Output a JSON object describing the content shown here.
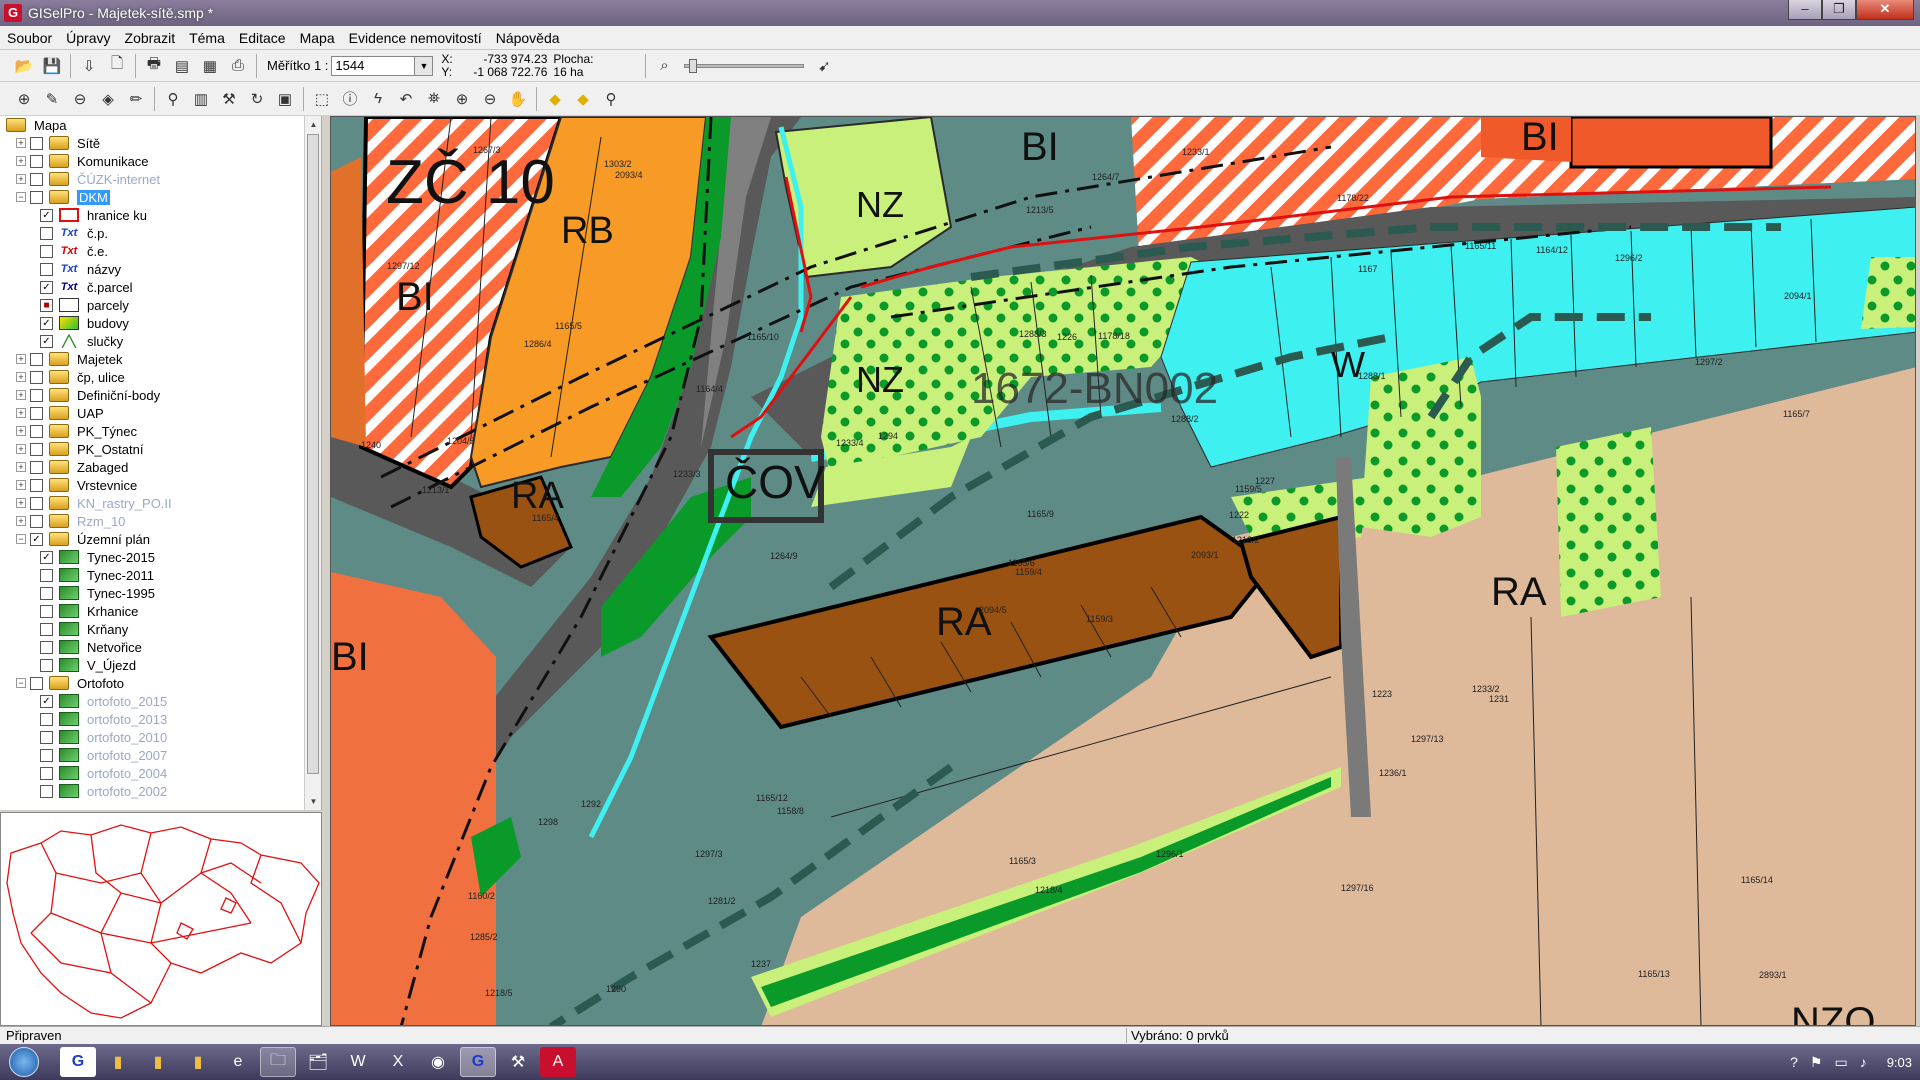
{
  "window": {
    "title": "GISelPro - Majetek-sítě.smp *",
    "minimize": "–",
    "maximize": "❐",
    "close": "✕",
    "app_icon": "G"
  },
  "menu": [
    "Soubor",
    "Úpravy",
    "Zobrazit",
    "Téma",
    "Editace",
    "Mapa",
    "Evidence nemovitostí",
    "Nápověda"
  ],
  "toolbar1": {
    "buttons_left": [
      {
        "name": "open-icon",
        "glyph": "📂"
      },
      {
        "name": "save-icon",
        "glyph": "💾"
      },
      {
        "name": "import-icon",
        "glyph": "⇩"
      },
      {
        "name": "new-page-icon",
        "glyph": "🗋"
      },
      {
        "name": "print-icon",
        "glyph": "🖶"
      },
      {
        "name": "print-preview-icon",
        "glyph": "▤"
      },
      {
        "name": "layout-icon",
        "glyph": "▦"
      },
      {
        "name": "export-icon",
        "glyph": "⎙"
      }
    ],
    "scale_label": "Měřítko 1 :",
    "scale_value": "1544",
    "x_label": "X:",
    "x_value": "-733 974.23",
    "y_label": "Y:",
    "y_value": "-1 068 722.76",
    "area_label": "Plocha:",
    "area_value": "16 ha",
    "zoom_icon": "⌕",
    "locate_icon": "➹"
  },
  "toolbar2": [
    {
      "name": "layer-add-icon",
      "glyph": "⊕"
    },
    {
      "name": "layer-edit-icon",
      "glyph": "✎"
    },
    {
      "name": "layer-remove-icon",
      "glyph": "⊖"
    },
    {
      "name": "compass-icon",
      "glyph": "◈"
    },
    {
      "name": "pen-icon",
      "glyph": "✏"
    },
    {
      "name": "binoculars-icon",
      "glyph": "⚲"
    },
    {
      "name": "calculator-icon",
      "glyph": "▥"
    },
    {
      "name": "tools-icon",
      "glyph": "⚒"
    },
    {
      "name": "refresh-icon",
      "glyph": "↻"
    },
    {
      "name": "grid-icon",
      "glyph": "▣"
    },
    {
      "name": "select-rect-icon",
      "glyph": "⬚"
    },
    {
      "name": "info-icon",
      "glyph": "ⓘ"
    },
    {
      "name": "lightning-icon",
      "glyph": "ϟ"
    },
    {
      "name": "undo-icon",
      "glyph": "↶"
    },
    {
      "name": "measure-icon",
      "glyph": "⛯"
    },
    {
      "name": "zoom-in-icon",
      "glyph": "⊕"
    },
    {
      "name": "zoom-out-icon",
      "glyph": "⊖"
    },
    {
      "name": "pan-hand-icon",
      "glyph": "✋"
    },
    {
      "name": "arrow-prev-icon",
      "glyph": "◆"
    },
    {
      "name": "arrow-next-icon",
      "glyph": "◆"
    },
    {
      "name": "find-icon",
      "glyph": "⚲"
    }
  ],
  "tree": [
    {
      "depth": 0,
      "exp": "",
      "chk": "",
      "icon": "layer",
      "label": "Mapa",
      "style": ""
    },
    {
      "depth": 1,
      "exp": "+",
      "chk": " ",
      "icon": "layer",
      "label": "Sítě",
      "style": ""
    },
    {
      "depth": 1,
      "exp": "+",
      "chk": " ",
      "icon": "layer",
      "label": "Komunikace",
      "style": ""
    },
    {
      "depth": 1,
      "exp": "+",
      "chk": " ",
      "icon": "layer",
      "label": "ČÚZK-internet",
      "style": "dim"
    },
    {
      "depth": 1,
      "exp": "−",
      "chk": " ",
      "icon": "layer",
      "label": "DKM",
      "style": "sel"
    },
    {
      "depth": 2,
      "exp": "",
      "chk": "✓",
      "icon": "redbox",
      "label": "hranice ku",
      "style": ""
    },
    {
      "depth": 2,
      "exp": "",
      "chk": " ",
      "icon": "txtblue",
      "label": "č.p.",
      "style": ""
    },
    {
      "depth": 2,
      "exp": "",
      "chk": " ",
      "icon": "txtred",
      "label": "č.e.",
      "style": ""
    },
    {
      "depth": 2,
      "exp": "",
      "chk": " ",
      "icon": "txtblue",
      "label": "názvy",
      "style": ""
    },
    {
      "depth": 2,
      "exp": "",
      "chk": "✓",
      "icon": "txtnavy",
      "label": "č.parcel",
      "style": ""
    },
    {
      "depth": 2,
      "exp": "",
      "chk": "■",
      "icon": "whitebox",
      "label": "parcely",
      "style": ""
    },
    {
      "depth": 2,
      "exp": "",
      "chk": "✓",
      "icon": "budovy",
      "label": "budovy",
      "style": ""
    },
    {
      "depth": 2,
      "exp": "",
      "chk": "✓",
      "icon": "line",
      "label": "slučky",
      "style": ""
    },
    {
      "depth": 1,
      "exp": "+",
      "chk": " ",
      "icon": "layer",
      "label": "Majetek",
      "style": ""
    },
    {
      "depth": 1,
      "exp": "+",
      "chk": " ",
      "icon": "layer",
      "label": "čp, ulice",
      "style": ""
    },
    {
      "depth": 1,
      "exp": "+",
      "chk": " ",
      "icon": "layer",
      "label": "Definiční-body",
      "style": ""
    },
    {
      "depth": 1,
      "exp": "+",
      "chk": " ",
      "icon": "layer",
      "label": "UAP",
      "style": ""
    },
    {
      "depth": 1,
      "exp": "+",
      "chk": " ",
      "icon": "layer",
      "label": "PK_Týnec",
      "style": ""
    },
    {
      "depth": 1,
      "exp": "+",
      "chk": " ",
      "icon": "layer",
      "label": "PK_Ostatní",
      "style": ""
    },
    {
      "depth": 1,
      "exp": "+",
      "chk": " ",
      "icon": "layer",
      "label": "Zabaged",
      "style": ""
    },
    {
      "depth": 1,
      "exp": "+",
      "chk": " ",
      "icon": "layer",
      "label": "Vrstevnice",
      "style": ""
    },
    {
      "depth": 1,
      "exp": "+",
      "chk": " ",
      "icon": "layer",
      "label": "KN_rastry_PO.II",
      "style": "dim"
    },
    {
      "depth": 1,
      "exp": "+",
      "chk": " ",
      "icon": "layer",
      "label": "Rzm_10",
      "style": "dim"
    },
    {
      "depth": 1,
      "exp": "−",
      "chk": "✓",
      "icon": "layer",
      "label": "Územní plán",
      "style": ""
    },
    {
      "depth": 2,
      "exp": "",
      "chk": "✓",
      "icon": "raster",
      "label": "Tynec-2015",
      "style": ""
    },
    {
      "depth": 2,
      "exp": "",
      "chk": " ",
      "icon": "raster",
      "label": "Tynec-2011",
      "style": ""
    },
    {
      "depth": 2,
      "exp": "",
      "chk": " ",
      "icon": "raster",
      "label": "Tynec-1995",
      "style": ""
    },
    {
      "depth": 2,
      "exp": "",
      "chk": " ",
      "icon": "raster",
      "label": "Krhanice",
      "style": ""
    },
    {
      "depth": 2,
      "exp": "",
      "chk": " ",
      "icon": "raster",
      "label": "Krňany",
      "style": ""
    },
    {
      "depth": 2,
      "exp": "",
      "chk": " ",
      "icon": "raster",
      "label": "Netvořice",
      "style": ""
    },
    {
      "depth": 2,
      "exp": "",
      "chk": " ",
      "icon": "raster",
      "label": "V_Újezd",
      "style": ""
    },
    {
      "depth": 1,
      "exp": "−",
      "chk": " ",
      "icon": "layer",
      "label": "Ortofoto",
      "style": ""
    },
    {
      "depth": 2,
      "exp": "",
      "chk": "✓",
      "icon": "raster",
      "label": "ortofoto_2015",
      "style": "dim"
    },
    {
      "depth": 2,
      "exp": "",
      "chk": " ",
      "icon": "raster",
      "label": "ortofoto_2013",
      "style": "dim"
    },
    {
      "depth": 2,
      "exp": "",
      "chk": " ",
      "icon": "raster",
      "label": "ortofoto_2010",
      "style": "dim"
    },
    {
      "depth": 2,
      "exp": "",
      "chk": " ",
      "icon": "raster",
      "label": "ortofoto_2007",
      "style": "dim"
    },
    {
      "depth": 2,
      "exp": "",
      "chk": " ",
      "icon": "raster",
      "label": "ortofoto_2004",
      "style": "dim"
    },
    {
      "depth": 2,
      "exp": "",
      "chk": " ",
      "icon": "raster",
      "label": "ortofoto_2002",
      "style": "dim"
    }
  ],
  "map": {
    "zone_labels": [
      {
        "text": "ZČ 10"
      },
      {
        "text": "RB"
      },
      {
        "text": "BI"
      },
      {
        "text": "NZ"
      },
      {
        "text": "BI"
      },
      {
        "text": "BI"
      },
      {
        "text": "NZ"
      },
      {
        "text": "W"
      },
      {
        "text": "RA"
      },
      {
        "text": "ČOV"
      },
      {
        "text": "RA"
      },
      {
        "text": "RA"
      },
      {
        "text": "BI"
      },
      {
        "text": "NZO"
      }
    ],
    "line_label": "1672-BN002",
    "parcel_labels": [
      "1159/3",
      "1286/4",
      "1159/4",
      "1160/2",
      "1159/5",
      "1158/8",
      "1178/22",
      "1178/18",
      "1167",
      "2093/1",
      "2093/4",
      "2893/1",
      "1165/4",
      "2094/1",
      "2094/5",
      "1288/1",
      "1290",
      "1288/3",
      "1288/2",
      "1292",
      "1294",
      "1285/2",
      "1281/2",
      "1226",
      "1227",
      "1231",
      "1165/5",
      "1213/5",
      "1213/1",
      "1223",
      "1165/7",
      "1165/6",
      "1165/3",
      "1165/9",
      "1165/10",
      "1165/11",
      "1165/12",
      "1165/13",
      "1165/14",
      "1233/2",
      "1233/1",
      "1233/4",
      "1233/3",
      "1236/1",
      "1237",
      "1240",
      "1222",
      "1218/5",
      "1218/4",
      "1218/2",
      "1298",
      "1297/2",
      "1297/12",
      "1297/13",
      "1297/16",
      "1297/3",
      "1303/2",
      "1267/3",
      "1296/1",
      "1296/2",
      "1264/7",
      "1264/9",
      "1204/5",
      "1164/4",
      "1164/12"
    ]
  },
  "statusbar": {
    "left": "Připraven",
    "selected": "Vybráno: 0  prvků"
  },
  "taskbar": {
    "apps": [
      {
        "name": "gisel-taskbar-icon",
        "glyph": "G"
      },
      {
        "name": "folder-taskbar-icon",
        "glyph": "▮"
      },
      {
        "name": "folder2-taskbar-icon",
        "glyph": "▮"
      },
      {
        "name": "folder3-taskbar-icon",
        "glyph": "▮"
      },
      {
        "name": "ie-taskbar-icon",
        "glyph": "e"
      },
      {
        "name": "explorer-taskbar-icon",
        "glyph": "🗀"
      },
      {
        "name": "files-taskbar-icon",
        "glyph": "🗂"
      },
      {
        "name": "word-taskbar-icon",
        "glyph": "W"
      },
      {
        "name": "excel-taskbar-icon",
        "glyph": "X"
      },
      {
        "name": "chrome-taskbar-icon",
        "glyph": "◉"
      },
      {
        "name": "gisel-active-taskbar-icon",
        "glyph": "G"
      },
      {
        "name": "tool-taskbar-icon",
        "glyph": "⚒"
      },
      {
        "name": "pdf-taskbar-icon",
        "glyph": "A"
      }
    ],
    "tray": [
      "?",
      "⚑",
      "▭",
      "♪"
    ],
    "time": "9:03"
  },
  "colors": {
    "bi_stripe": "#ff6a3c",
    "rb": "#f79a26",
    "ra": "#9a5212",
    "nz": "#c8f07a",
    "water": "#3ff0f0",
    "road": "#595959",
    "cov": "#5a8c84",
    "beige": "#deb99a",
    "forest": "#0a9a2a"
  }
}
